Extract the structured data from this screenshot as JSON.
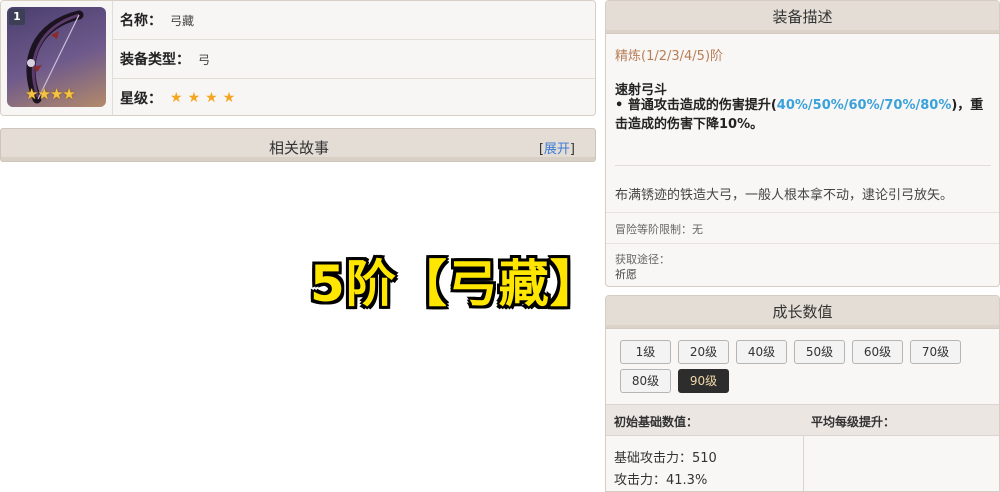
{
  "info": {
    "rank_badge": "1",
    "name_label": "名称：",
    "name_value": "弓藏",
    "type_label": "装备类型：",
    "type_value": "弓",
    "stars_label": "星级：",
    "star_count": 4,
    "star_glyph": "★",
    "star_color": "#f4a521"
  },
  "story": {
    "title": "相关故事",
    "toggle_open": "[",
    "toggle_link": "展开",
    "toggle_close": "]"
  },
  "overlay": {
    "text": "5阶【弓藏】",
    "color": "#ffe600"
  },
  "description": {
    "header": "装备描述",
    "refine": "精炼(1/2/3/4/5)阶",
    "skill_name": "速射弓斗",
    "skill_prefix": "• 普通攻击造成的伤害提升(",
    "skill_values": "40%/50%/60%/70%/80%",
    "skill_suffix": ")，重击造成的伤害下降10%。",
    "highlight_color": "#3ba1d9",
    "flavor": "布满锈迹的铁造大弓，一般人根本拿不动，逮论引弓放矢。",
    "limit": "冒险等阶限制：无",
    "source_label": "获取途径：",
    "source_value": "祈愿"
  },
  "growth": {
    "header": "成长数值",
    "levels": [
      "1级",
      "20级",
      "40级",
      "50级",
      "60级",
      "70级",
      "80级",
      "90级"
    ],
    "active_level": "90级",
    "col1_header": "初始基础数值：",
    "col2_header": "平均每级提升：",
    "stat1": "基础攻击力：510",
    "stat2": "攻击力：41.3%"
  }
}
